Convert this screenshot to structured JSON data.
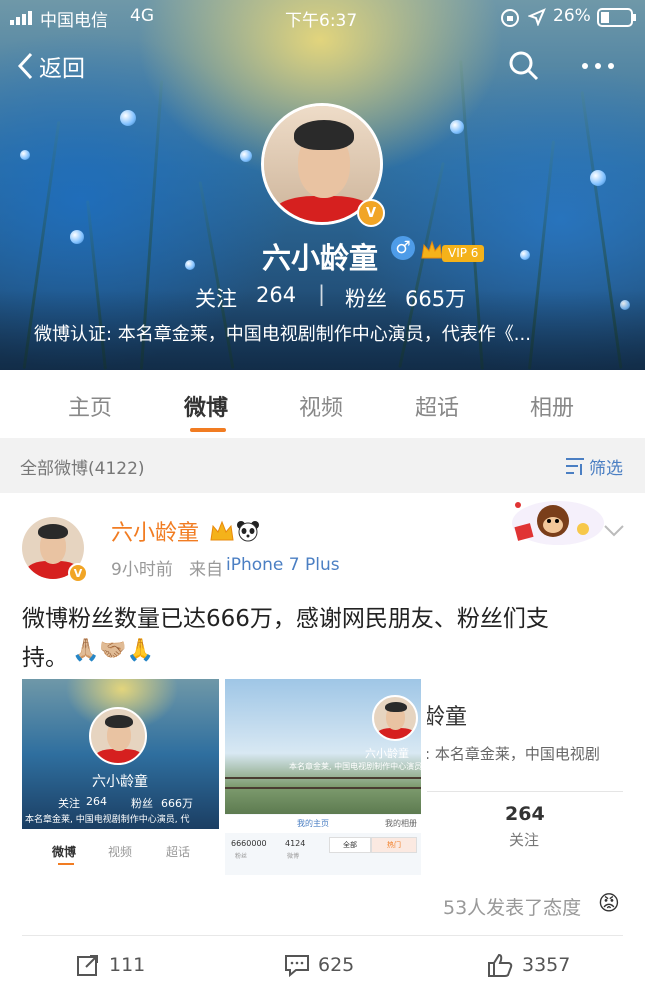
{
  "status_bar": {
    "carrier": "中国电信",
    "network": "4G",
    "time": "下午6:37",
    "battery": "26%"
  },
  "nav": {
    "back_label": "返回"
  },
  "profile": {
    "name": "六小龄童",
    "gender_symbol": "♂",
    "vip_label": "VIP 6",
    "following_label": "关注",
    "following_count": "264",
    "separator": "|",
    "followers_label": "粉丝",
    "followers_count": "665万",
    "verification": "微博认证: 本名章金莱，中国电视剧制作中心演员，代表作《...",
    "v_badge": "V"
  },
  "tabs": [
    {
      "label": "主页"
    },
    {
      "label": "微博"
    },
    {
      "label": "视频"
    },
    {
      "label": "超话"
    },
    {
      "label": "相册"
    }
  ],
  "filter": {
    "all_posts": "全部微博(4122)",
    "filter_label": "筛选"
  },
  "post": {
    "author": "六小龄童",
    "time": "9小时前",
    "source_prefix": "来自",
    "source": "iPhone 7 Plus",
    "text_line1": "微博粉丝数量已达666万，感谢网民朋友、粉丝们支",
    "text_line2": "持。",
    "emoji": "🙏🏼🤝🏼🙏",
    "reactions": "53人发表了态度",
    "reaction_emoji": "😡",
    "repost_count": "111",
    "comment_count": "625",
    "like_count": "3357"
  },
  "thumb1": {
    "name": "六小龄童",
    "following_label": "关注",
    "following_count": "264",
    "followers_label": "粉丝",
    "followers_count": "666万",
    "verification": "本名章金莱, 中国电视剧制作中心演员, 代",
    "tabs": [
      "微博",
      "视频",
      "超话"
    ]
  },
  "thumb2": {
    "name": "六小龄童",
    "verification": "本名章金莱, 中国电视剧制作中心演员",
    "tab_a": "我的主页",
    "tab_b": "我的相册",
    "n1": "6660000",
    "n1_label": "粉丝",
    "n2": "4124",
    "n2_label": "微博",
    "btn_all": "全部",
    "btn_hot": "热门"
  },
  "thumb3": {
    "name_part": "龄童",
    "verification": ": 本名章金莱，中国电视剧",
    "count": "264",
    "count_label": "关注"
  },
  "colors": {
    "accent_orange": "#f17c22",
    "link_blue": "#4b7fc3",
    "name_orange": "#f17c22",
    "vip_gold": "#f4b21a"
  }
}
